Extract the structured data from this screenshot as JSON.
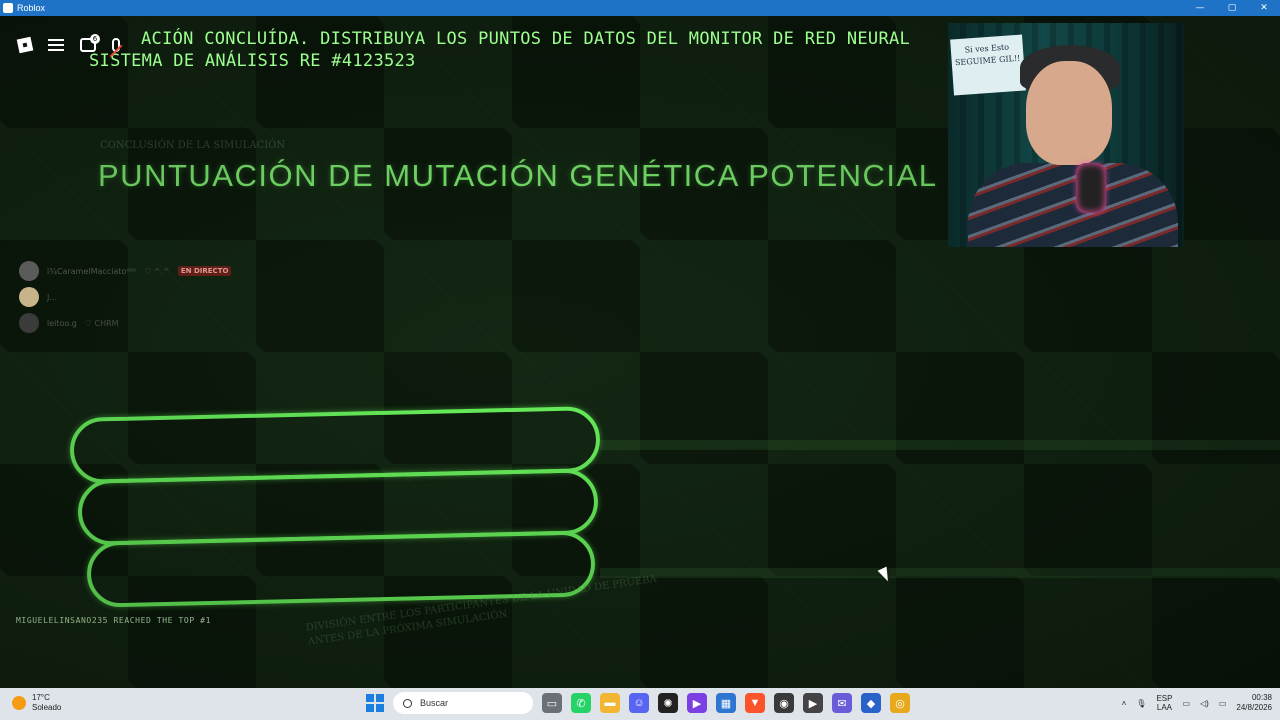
{
  "window": {
    "title": "Roblox",
    "controls": [
      "—",
      "▢",
      "✕"
    ]
  },
  "topbar": {
    "chat_badge": "6"
  },
  "banner": {
    "line1": "ACIÓN CONCLUÍDA. DISTRIBUYA LOS PUNTOS DE DATOS DEL MONITOR DE RED NEURAL",
    "line2": "SISTEMA DE ANÁLISIS RE #4123523"
  },
  "sim_caption": "CONCLUSIÓN DE LA SIMULACIÓN",
  "headline": "PUNTUACIÓN DE MUTACIÓN GENÉTICA POTENCIAL",
  "stream_chat": [
    {
      "name": "ï¾CaramelMacciato⁰⁰ᴬ",
      "tag": "♡ ^.^",
      "live": "EN DIRECTO"
    },
    {
      "name": "J...",
      "tag": "",
      "live": ""
    },
    {
      "name": "leitoo.g",
      "tag": "♡ CHRM",
      "live": ""
    }
  ],
  "webcam": {
    "note": "Si ves Esto SEGUIME GIL!!"
  },
  "reached_text": "MIGUELELINSANO235 REACHED THE TOP  #1",
  "division_text": {
    "line1": "DIVISIÓN ENTRE LOS PARTICIPANTES DE LA UNIDAD DE PRUEBA",
    "line2": "ANTES DE LA PRÓXIMA SIMULACIÓN"
  },
  "taskbar": {
    "weather_temp": "17°C",
    "weather_desc": "Soleado",
    "search_placeholder": "Buscar",
    "apps": [
      {
        "name": "files-icon",
        "color": "#6b6f76",
        "glyph": "▭"
      },
      {
        "name": "whatsapp-icon",
        "color": "#25d366",
        "glyph": "✆"
      },
      {
        "name": "folder-icon",
        "color": "#f2b632",
        "glyph": "▬"
      },
      {
        "name": "discord-icon",
        "color": "#5865f2",
        "glyph": "☺"
      },
      {
        "name": "chatgpt-icon",
        "color": "#222222",
        "glyph": "✺"
      },
      {
        "name": "clapper-icon",
        "color": "#7b3fe4",
        "glyph": "▶"
      },
      {
        "name": "store-icon",
        "color": "#2f76d2",
        "glyph": "▦"
      },
      {
        "name": "brave-icon",
        "color": "#fb542b",
        "glyph": "▼"
      },
      {
        "name": "obs-icon",
        "color": "#3a3a3a",
        "glyph": "◉"
      },
      {
        "name": "player-icon",
        "color": "#444444",
        "glyph": "▶"
      },
      {
        "name": "messenger-icon",
        "color": "#6a5bd9",
        "glyph": "✉"
      },
      {
        "name": "roblox-icon",
        "color": "#2962c9",
        "glyph": "◆"
      },
      {
        "name": "chrome-icon",
        "color": "#e8a81c",
        "glyph": "◎"
      }
    ],
    "lang_top": "ESP",
    "lang_bottom": "LAA",
    "time": "00:38",
    "date": "24/8/2026"
  }
}
